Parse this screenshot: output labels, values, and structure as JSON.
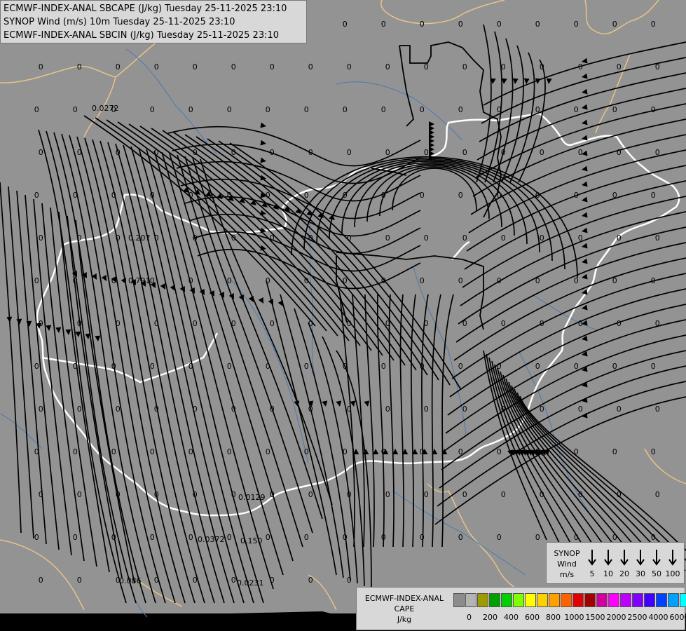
{
  "header": {
    "line1": "ECMWF-INDEX-ANAL SBCAPE (J/kg) Tuesday 25-11-2025 23:10",
    "line2": "SYNOP Wind (m/s) 10m Tuesday 25-11-2025 23:10",
    "line3": "ECMWF-INDEX-ANAL SBCIN (J/kg) Tuesday 25-11-2025 23:10"
  },
  "colors": {
    "background": "#939393",
    "streamline": "#000000",
    "border": "#ffffff",
    "region_border": "#e8c48a",
    "river": "#4a7ab0"
  },
  "wind_legend": {
    "title": "SYNOP",
    "subtitle": "Wind",
    "unit": "m/s",
    "values": [
      "5",
      "10",
      "20",
      "30",
      "50",
      "100"
    ]
  },
  "cape_legend": {
    "title": "ECMWF-INDEX-ANAL",
    "subtitle": "CAPE",
    "unit": "J/kg",
    "colors": [
      "#8c8c8c",
      "#b4b4b4",
      "#9c9c00",
      "#00a000",
      "#00d000",
      "#80ff00",
      "#ffff00",
      "#ffd000",
      "#ffa000",
      "#ff6000",
      "#e00000",
      "#a00000",
      "#d000a0",
      "#ff00ff",
      "#c000ff",
      "#8000ff",
      "#4000ff",
      "#0040ff",
      "#00a0ff",
      "#00ffff",
      "#80ffff",
      "#ffffff"
    ],
    "ticks": [
      "0",
      "200",
      "400",
      "600",
      "800",
      "1000",
      "1500",
      "2000",
      "2500",
      "4000",
      "6000"
    ]
  },
  "value_labels": [
    "0.0272",
    "0.207",
    "0.791",
    "0.0129",
    "0.0372",
    "0.150",
    "0.0231",
    "0.086",
    "0"
  ]
}
